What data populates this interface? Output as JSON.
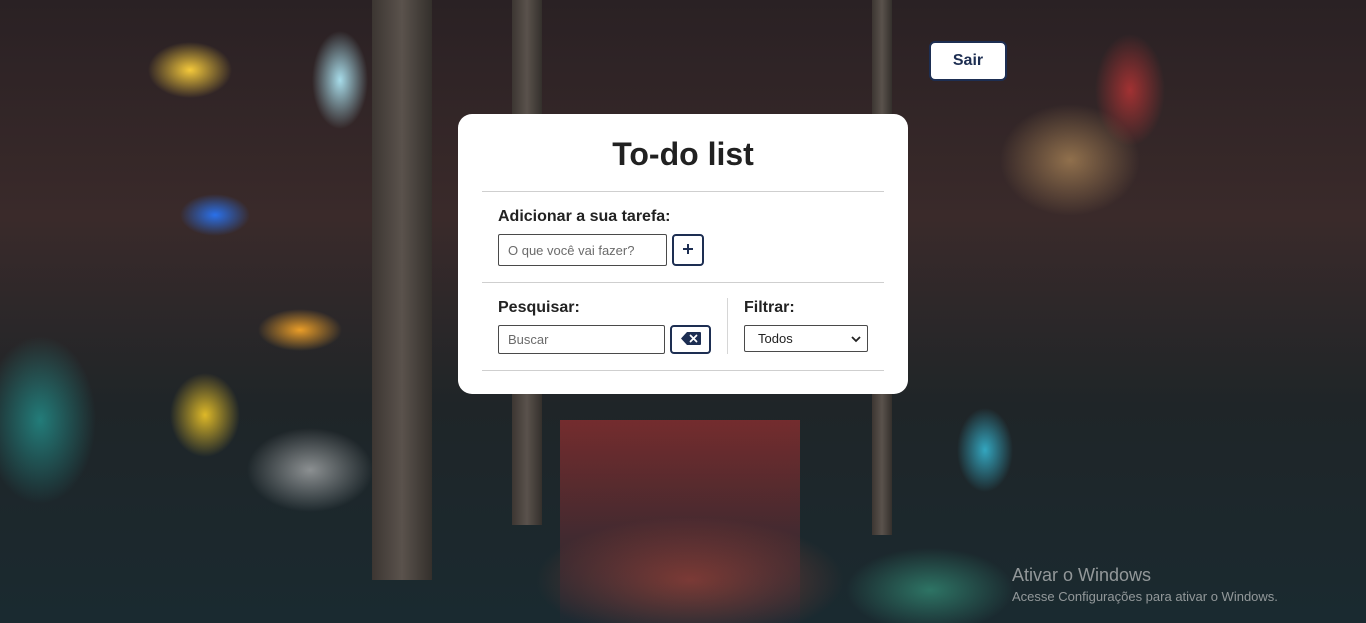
{
  "header": {
    "logout_label": "Sair"
  },
  "todo": {
    "title": "To-do list",
    "add_label": "Adicionar a sua tarefa:",
    "add_placeholder": "O que você vai fazer?",
    "add_button_icon": "plus-icon",
    "search_label": "Pesquisar:",
    "search_placeholder": "Buscar",
    "clear_button_icon": "backspace-icon",
    "filter_label": "Filtrar:",
    "filter_selected": "Todos"
  },
  "watermark": {
    "title": "Ativar o Windows",
    "subtitle": "Acesse Configurações para ativar o Windows."
  },
  "colors": {
    "accent": "#1d2e52",
    "card_background": "#ffffff",
    "text": "#212121"
  }
}
